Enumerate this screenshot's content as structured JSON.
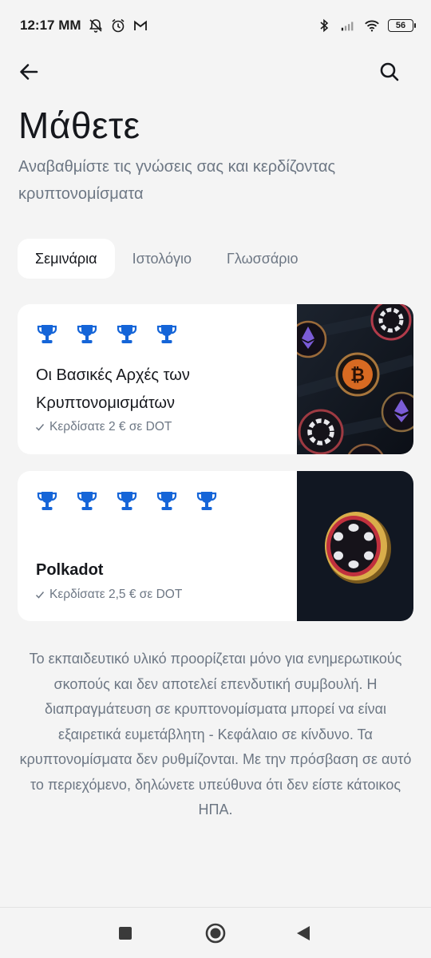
{
  "status": {
    "time": "12:17 MM",
    "battery": "56"
  },
  "page": {
    "title": "Μάθετε",
    "subtitle": "Αναβαθμίστε τις γνώσεις σας και κερδίζοντας κρυπτονομίσματα"
  },
  "tabs": [
    {
      "label": "Σεμινάρια",
      "active": true
    },
    {
      "label": "Ιστολόγιο",
      "active": false
    },
    {
      "label": "Γλωσσάριο",
      "active": false
    }
  ],
  "courses": [
    {
      "title": "Οι Βασικές Αρχές των Κρυπτονομισμάτων",
      "earned": "Κερδίσατε 2 € σε DOT",
      "trophy_count": 4
    },
    {
      "title": "Polkadot",
      "earned": "Κερδίσατε 2,5 € σε DOT",
      "trophy_count": 5
    }
  ],
  "disclaimer": "Το εκπαιδευτικό υλικό προορίζεται μόνο για ενημερωτικούς σκοπούς και δεν αποτελεί επενδυτική συμβουλή. Η διαπραγμάτευση σε κρυπτονομίσματα μπορεί να είναι εξαιρετικά ευμετάβλητη - Κεφάλαιο σε κίνδυνο. Τα κρυπτονομίσματα δεν ρυθμίζονται. Με την πρόσβαση σε αυτό το περιεχόμενο, δηλώνετε υπεύθυνα ότι δεν είστε κάτοικος ΗΠΑ.",
  "colors": {
    "accent": "#1565d8",
    "background": "#f4f4f4",
    "muted_text": "#6d7784"
  },
  "icons": {
    "back": "arrow-left-icon",
    "search": "search-icon",
    "trophy": "trophy-icon"
  }
}
